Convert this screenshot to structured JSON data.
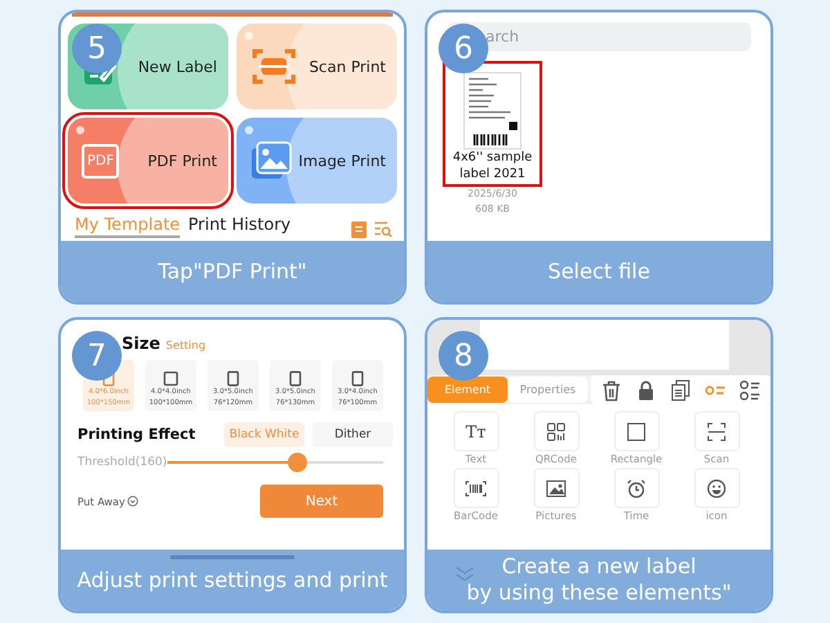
{
  "panels": [
    {
      "kind": "home",
      "step": "5",
      "caption": "Tap\"PDF Print\"",
      "tiles": [
        {
          "kind": "edit",
          "label": "New Label",
          "color": "#6fcfa8",
          "highlighted": false
        },
        {
          "kind": "scan",
          "label": "Scan Print",
          "color": "#fcd9bd",
          "highlighted": false
        },
        {
          "kind": "pdf",
          "label": "PDF Print",
          "color": "#f47f66",
          "glyph": "PDF",
          "highlighted": true
        },
        {
          "kind": "image",
          "label": "Image Print",
          "color": "#7fb3f5",
          "highlighted": false
        }
      ],
      "tabs": [
        {
          "label": "My Template",
          "selected": true
        },
        {
          "label": "Print History",
          "selected": false
        }
      ]
    },
    {
      "kind": "files",
      "step": "6",
      "caption": "Select file",
      "search": {
        "placeholder": "arch"
      },
      "files": [
        {
          "name": "4x6'' sample label 2021",
          "date": "2025/6/30",
          "size": "608 KB",
          "highlighted": true
        }
      ]
    },
    {
      "kind": "settings",
      "step": "7",
      "caption": "Adjust print settings and print",
      "title": "Size",
      "title_link": "Setting",
      "sizes": [
        {
          "kind": "portrait",
          "inch": "4.0*6.0inch",
          "mm": "100*150mm",
          "selected": true
        },
        {
          "kind": "square",
          "inch": "4.0*4.0inch",
          "mm": "100*100mm",
          "selected": false
        },
        {
          "kind": "portrait",
          "inch": "3.0*5.0inch",
          "mm": "76*120mm",
          "selected": false
        },
        {
          "kind": "portrait",
          "inch": "3.0*5.0inch",
          "mm": "76*130mm",
          "selected": false
        },
        {
          "kind": "portrait",
          "inch": "3.0*4.0inch",
          "mm": "76*100mm",
          "selected": false
        }
      ],
      "effect_label": "Printing Effect",
      "effects": [
        {
          "label": "Black White",
          "selected": true
        },
        {
          "label": "Dither",
          "selected": false
        }
      ],
      "threshold": {
        "label": "Threshold(160)",
        "level": 0.6
      },
      "put_away": "Put Away",
      "next": "Next"
    },
    {
      "kind": "editor",
      "step": "8",
      "caption_lines": [
        "Create a new label",
        "by using these elements\""
      ],
      "tabs": [
        {
          "label": "Element",
          "selected": true
        },
        {
          "label": "Properties",
          "selected": false
        }
      ],
      "tools": [
        {
          "kind": "trash",
          "selected": false
        },
        {
          "kind": "lock",
          "selected": false
        },
        {
          "kind": "copy",
          "selected": false
        },
        {
          "kind": "align",
          "selected": true
        },
        {
          "kind": "list",
          "selected": false
        }
      ],
      "elements": [
        {
          "kind": "text",
          "label": "Text",
          "glyph": "Tт"
        },
        {
          "kind": "qrcode",
          "label": "QRCode"
        },
        {
          "kind": "rectangle",
          "label": "Rectangle"
        },
        {
          "kind": "scan",
          "label": "Scan"
        },
        {
          "kind": "barcode",
          "label": "BarCode"
        },
        {
          "kind": "picture",
          "label": "Pictures"
        },
        {
          "kind": "time",
          "label": "Time"
        },
        {
          "kind": "emoji",
          "label": "icon"
        }
      ]
    }
  ]
}
